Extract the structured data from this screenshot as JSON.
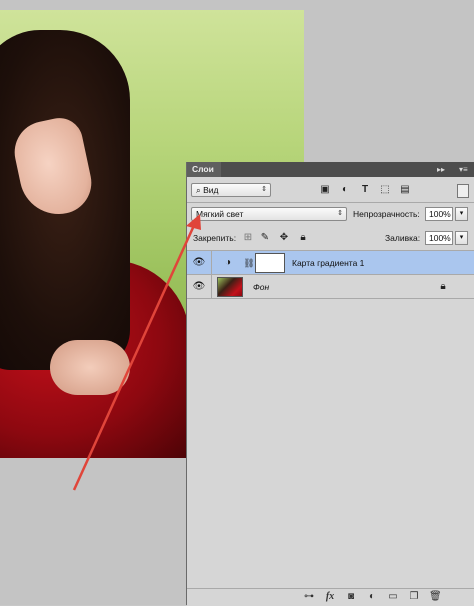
{
  "panel": {
    "tab_title": "Слои",
    "tab_collapse_icon": "double-chevron-icon",
    "tab_menu_icon": "panel-menu-icon"
  },
  "filter": {
    "kind_label": "Вид",
    "icons": [
      "image-filter-icon",
      "adjustment-filter-icon",
      "type-filter-icon",
      "shape-filter-icon",
      "smart-object-filter-icon"
    ]
  },
  "blend": {
    "mode": "Мягкий свет",
    "opacity_label": "Непрозрачность:",
    "opacity_value": "100%"
  },
  "lock": {
    "label": "Закрепить:",
    "fill_label": "Заливка:",
    "fill_value": "100%"
  },
  "layers": [
    {
      "name": "Карта градиента 1",
      "selected": true,
      "type": "adjustment"
    },
    {
      "name": "Фон",
      "selected": false,
      "type": "background",
      "locked": true
    }
  ],
  "bottom_icons": [
    "link-layers-icon",
    "fx-icon",
    "add-mask-icon",
    "new-adjustment-icon",
    "new-group-icon",
    "new-layer-icon",
    "delete-layer-icon"
  ],
  "colors": {
    "selected_layer": "#aac6ee",
    "panel_bg": "#d6d6d6",
    "annotation_arrow": "#e0453a"
  }
}
